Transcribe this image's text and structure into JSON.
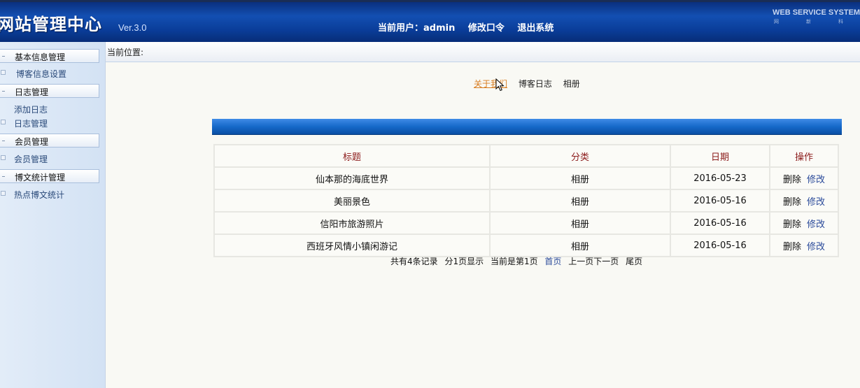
{
  "header": {
    "logo": "网站管理中心",
    "version": "Ver.3.0",
    "current_user_label": "当前用户：admin",
    "change_password": "修改口令",
    "logout": "退出系统",
    "brand": "WEB SERVICE SYSTEM",
    "brand_sub": [
      "网",
      "新",
      "科"
    ]
  },
  "sidebar": {
    "groups": [
      {
        "title": "基本信息管理",
        "items": [
          "博客信息设置"
        ]
      },
      {
        "title": "日志管理",
        "items": [
          "添加日志",
          "日志管理"
        ]
      },
      {
        "title": "会员管理",
        "items": [
          "会员管理"
        ]
      },
      {
        "title": "博文统计管理",
        "items": [
          "热点博文统计"
        ]
      }
    ]
  },
  "location_label": "当前位置:",
  "tabs": [
    "关于我们",
    "博客日志",
    "相册"
  ],
  "table": {
    "headers": [
      "标题",
      "分类",
      "日期",
      "操作"
    ],
    "rows": [
      {
        "title": "仙本那的海底世界",
        "category": "相册",
        "date": "2016-05-23"
      },
      {
        "title": "美丽景色",
        "category": "相册",
        "date": "2016-05-16"
      },
      {
        "title": "信阳市旅游照片",
        "category": "相册",
        "date": "2016-05-16"
      },
      {
        "title": "西班牙风情小镇闲游记",
        "category": "相册",
        "date": "2016-05-16"
      }
    ],
    "delete_label": "删除",
    "edit_label": "修改"
  },
  "pager": {
    "total": "共有4条记录",
    "pages": "分1页显示",
    "current": "当前是第1页",
    "first": "首页",
    "prev_next": "上一页下一页",
    "last": "尾页"
  },
  "colors": {
    "header_blue": "#134fb2",
    "table_header_text": "#8b1a1a",
    "active_tab": "#d87c1f",
    "link_blue": "#2a4a9a"
  }
}
